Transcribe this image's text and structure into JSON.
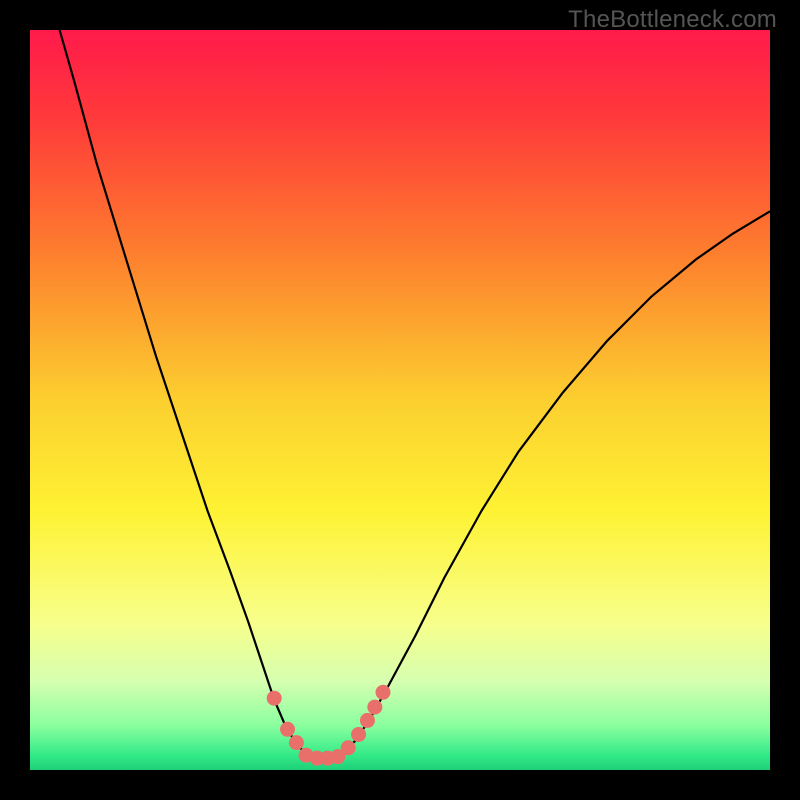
{
  "watermark": "TheBottleneck.com",
  "chart_data": {
    "type": "line",
    "title": "",
    "xlabel": "",
    "ylabel": "",
    "xlim": [
      0,
      1
    ],
    "ylim": [
      0,
      1
    ],
    "gradient_stops": [
      {
        "offset": 0.0,
        "color": "#ff1a4b"
      },
      {
        "offset": 0.12,
        "color": "#ff3a3a"
      },
      {
        "offset": 0.3,
        "color": "#fd7e2e"
      },
      {
        "offset": 0.5,
        "color": "#fccf2f"
      },
      {
        "offset": 0.65,
        "color": "#fef233"
      },
      {
        "offset": 0.8,
        "color": "#f7ff8a"
      },
      {
        "offset": 0.88,
        "color": "#d6ffb0"
      },
      {
        "offset": 0.94,
        "color": "#8aff9f"
      },
      {
        "offset": 0.98,
        "color": "#33ea88"
      },
      {
        "offset": 1.0,
        "color": "#1ecf78"
      }
    ],
    "curve": [
      {
        "x": 0.04,
        "y": 1.0
      },
      {
        "x": 0.06,
        "y": 0.93
      },
      {
        "x": 0.09,
        "y": 0.82
      },
      {
        "x": 0.13,
        "y": 0.69
      },
      {
        "x": 0.17,
        "y": 0.56
      },
      {
        "x": 0.21,
        "y": 0.44
      },
      {
        "x": 0.24,
        "y": 0.35
      },
      {
        "x": 0.27,
        "y": 0.27
      },
      {
        "x": 0.295,
        "y": 0.2
      },
      {
        "x": 0.315,
        "y": 0.14
      },
      {
        "x": 0.33,
        "y": 0.095
      },
      {
        "x": 0.345,
        "y": 0.06
      },
      {
        "x": 0.36,
        "y": 0.035
      },
      {
        "x": 0.375,
        "y": 0.02
      },
      {
        "x": 0.39,
        "y": 0.014
      },
      {
        "x": 0.405,
        "y": 0.014
      },
      {
        "x": 0.422,
        "y": 0.022
      },
      {
        "x": 0.44,
        "y": 0.04
      },
      {
        "x": 0.46,
        "y": 0.07
      },
      {
        "x": 0.485,
        "y": 0.115
      },
      {
        "x": 0.52,
        "y": 0.18
      },
      {
        "x": 0.56,
        "y": 0.26
      },
      {
        "x": 0.61,
        "y": 0.35
      },
      {
        "x": 0.66,
        "y": 0.43
      },
      {
        "x": 0.72,
        "y": 0.51
      },
      {
        "x": 0.78,
        "y": 0.58
      },
      {
        "x": 0.84,
        "y": 0.64
      },
      {
        "x": 0.9,
        "y": 0.69
      },
      {
        "x": 0.95,
        "y": 0.725
      },
      {
        "x": 1.0,
        "y": 0.755
      }
    ],
    "markers": [
      {
        "x": 0.33,
        "y": 0.097
      },
      {
        "x": 0.348,
        "y": 0.055
      },
      {
        "x": 0.36,
        "y": 0.037
      },
      {
        "x": 0.373,
        "y": 0.02
      },
      {
        "x": 0.388,
        "y": 0.016
      },
      {
        "x": 0.402,
        "y": 0.016
      },
      {
        "x": 0.416,
        "y": 0.018
      },
      {
        "x": 0.43,
        "y": 0.03
      },
      {
        "x": 0.444,
        "y": 0.048
      },
      {
        "x": 0.456,
        "y": 0.067
      },
      {
        "x": 0.466,
        "y": 0.085
      },
      {
        "x": 0.477,
        "y": 0.105
      }
    ],
    "marker_color": "#e96f6b",
    "curve_color": "#000000"
  }
}
